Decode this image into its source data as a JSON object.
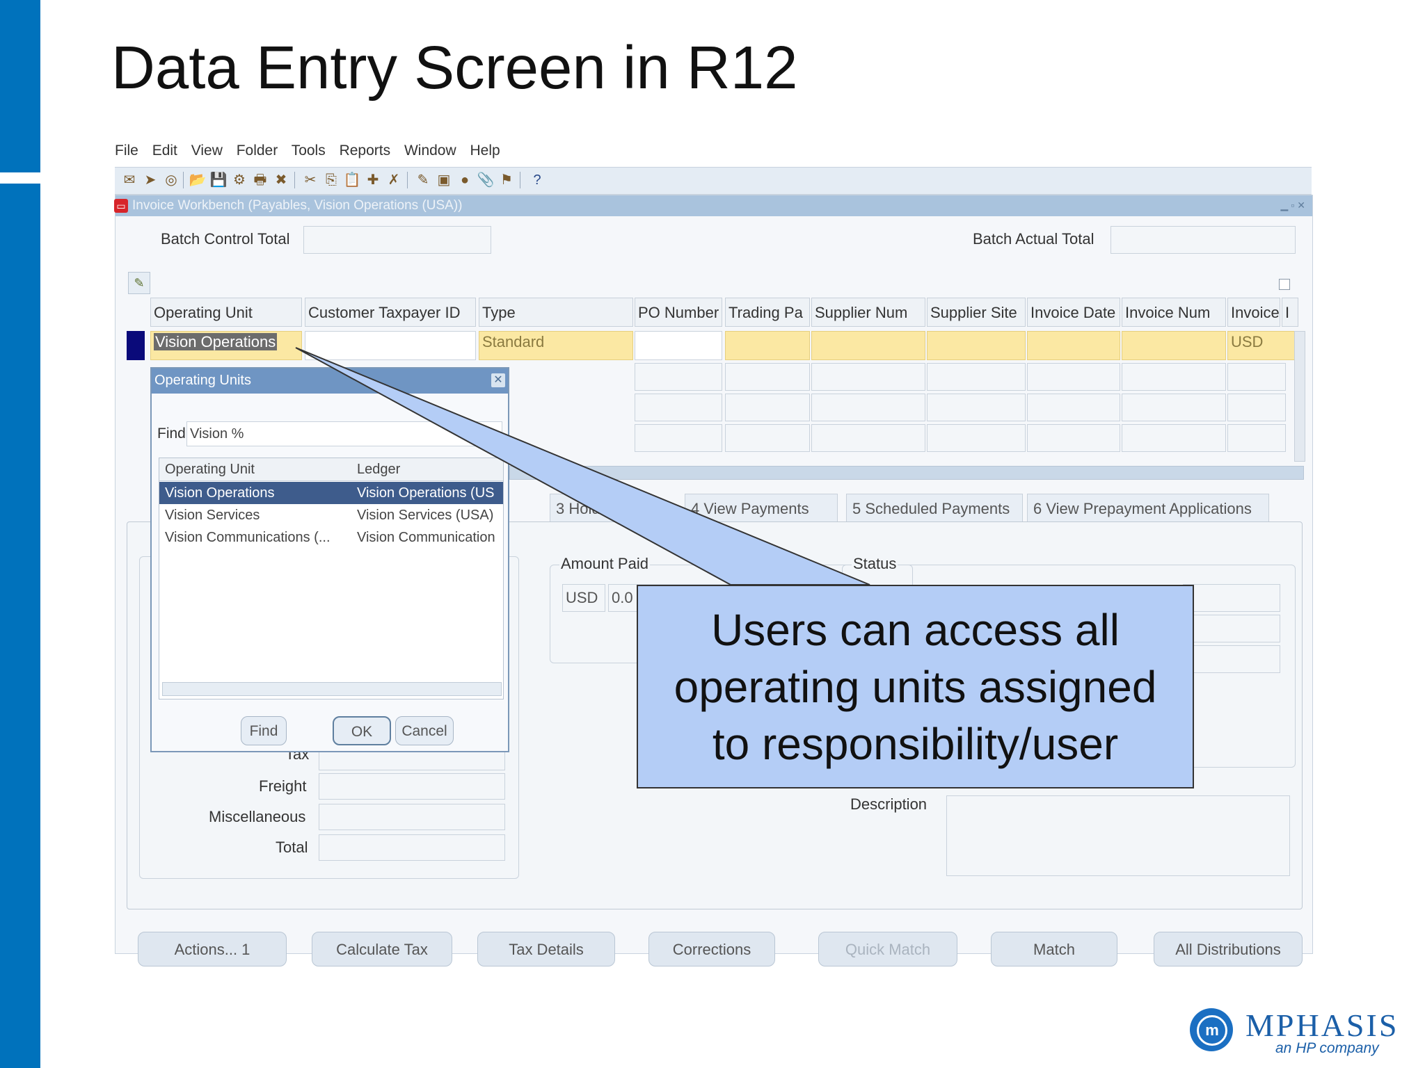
{
  "slide": {
    "title": "Data Entry Screen in R12"
  },
  "menu": [
    "File",
    "Edit",
    "View",
    "Folder",
    "Tools",
    "Reports",
    "Window",
    "Help"
  ],
  "window": {
    "title": "Invoice Workbench (Payables, Vision Operations (USA))"
  },
  "batch": {
    "control_total_label": "Batch Control Total",
    "actual_total_label": "Batch Actual Total"
  },
  "grid": {
    "columns": [
      "Operating Unit",
      "Customer Taxpayer ID",
      "Type",
      "PO Number",
      "Trading Pa",
      "Supplier Num",
      "Supplier Site",
      "Invoice Date",
      "Invoice Num",
      "Invoice",
      "I"
    ],
    "row": {
      "operating_unit": "Vision Operations",
      "type": "Standard",
      "currency": "USD"
    }
  },
  "tabs": {
    "holds": "3 Holds",
    "view_payments": "4 View Payments",
    "scheduled_payments": "5 Scheduled Payments",
    "prepayments": "6 View Prepayment Applications"
  },
  "summary": {
    "amount_paid_label": "Amount Paid",
    "status_label": "Status",
    "currency": "USD",
    "amount": "0.0",
    "tax_label": "Tax",
    "freight_label": "Freight",
    "misc_label": "Miscellaneous",
    "total_label": "Total",
    "description_label": "Description"
  },
  "dialog": {
    "title": "Operating Units",
    "find_label": "Find",
    "find_value": "Vision %",
    "col_ou": "Operating Unit",
    "col_ledger": "Ledger",
    "rows": [
      {
        "ou": "Vision Operations",
        "ledger": "Vision Operations (US"
      },
      {
        "ou": "Vision Services",
        "ledger": "Vision Services (USA)"
      },
      {
        "ou": "Vision Communications (...",
        "ledger": "Vision Communication"
      }
    ],
    "find_btn": "Find",
    "ok_btn": "OK",
    "cancel_btn": "Cancel"
  },
  "buttons": {
    "actions": "Actions... 1",
    "calculate_tax": "Calculate Tax",
    "tax_details": "Tax Details",
    "corrections": "Corrections",
    "quick_match": "Quick Match",
    "match": "Match",
    "all_distributions": "All Distributions"
  },
  "callout": {
    "line1": "Users can access all",
    "line2": "operating units assigned",
    "line3": "to responsibility/user"
  },
  "logo": {
    "name": "MPHASIS",
    "tagline": "an HP company"
  }
}
